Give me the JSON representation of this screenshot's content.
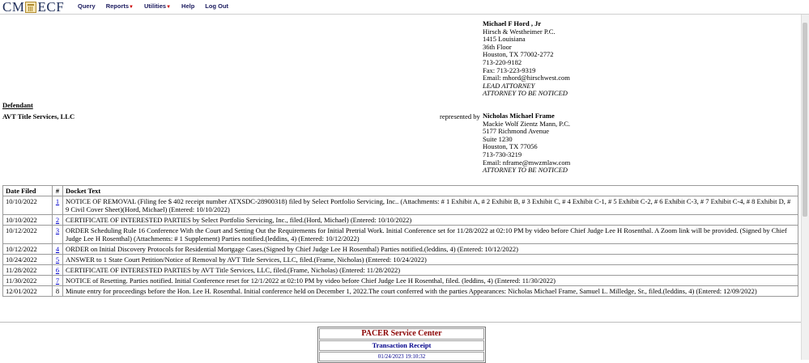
{
  "brand": {
    "cm": "CM",
    "ecf": "ECF"
  },
  "nav": [
    {
      "label": "Query",
      "dropdown": false
    },
    {
      "label": "Reports",
      "dropdown": true
    },
    {
      "label": "Utilities",
      "dropdown": true
    },
    {
      "label": "Help",
      "dropdown": false
    },
    {
      "label": "Log Out",
      "dropdown": false
    }
  ],
  "attorney_top": {
    "name": "Michael F Hord , Jr",
    "lines": [
      "Hirsch & Westheimer P.C.",
      "1415 Louisiana",
      "36th Floor",
      "Houston, TX 77002-2772",
      "713-220-9182",
      "Fax: 713-223-9319",
      "Email: mhord@hirschwest.com"
    ],
    "tags": [
      "LEAD ATTORNEY",
      "ATTORNEY TO BE NOTICED"
    ]
  },
  "defendant": {
    "header": "Defendant",
    "name": "AVT Title Services, LLC",
    "represented_by": "represented by",
    "attorney": {
      "name": "Nicholas Michael Frame",
      "lines": [
        "Mackie Wolf Zientz Mann, P.C.",
        "5177 Richmond Avenue",
        "Suite 1230",
        "Houston, TX 77056",
        "713-730-3219",
        "Email: nframe@mwzmlaw.com"
      ],
      "tags": [
        "ATTORNEY TO BE NOTICED"
      ]
    }
  },
  "docket": {
    "headers": [
      "Date Filed",
      "#",
      "Docket Text"
    ],
    "rows": [
      {
        "date": "10/10/2022",
        "num": "1",
        "link": true,
        "text": "NOTICE OF REMOVAL (Filing fee $ 402 receipt number ATXSDC-28900318) filed by Select Portfolio Servicing, Inc.. (Attachments: # 1 Exhibit A, # 2 Exhibit B, # 3 Exhibit C, # 4 Exhibit C-1, # 5 Exhibit C-2, # 6 Exhibit C-3, # 7 Exhibit C-4, # 8 Exhibit D, # 9 Civil Cover Sheet)(Hord, Michael) (Entered: 10/10/2022)"
      },
      {
        "date": "10/10/2022",
        "num": "2",
        "link": true,
        "text": "CERTIFICATE OF INTERESTED PARTIES by Select Portfolio Servicing, Inc., filed.(Hord, Michael) (Entered: 10/10/2022)"
      },
      {
        "date": "10/12/2022",
        "num": "3",
        "link": true,
        "text": "ORDER Scheduling Rule 16 Conference With the Court and Setting Out the Requirements for Initial Pretrial Work. Initial Conference set for 11/28/2022 at 02:10 PM by video before Chief Judge Lee H Rosenthal. A Zoom link will be provided. (Signed by Chief Judge Lee H Rosenthal) (Attachments: # 1 Supplement) Parties notified.(leddins, 4) (Entered: 10/12/2022)"
      },
      {
        "date": "10/12/2022",
        "num": "4",
        "link": true,
        "text": "ORDER on Initial Discovery Protocols for Residential Mortgage Cases.(Signed by Chief Judge Lee H Rosenthal) Parties notified.(leddins, 4) (Entered: 10/12/2022)"
      },
      {
        "date": "10/24/2022",
        "num": "5",
        "link": true,
        "text": "ANSWER to 1 State Court Petition/Notice of Removal by AVT Title Services, LLC, filed.(Frame, Nicholas) (Entered: 10/24/2022)"
      },
      {
        "date": "11/28/2022",
        "num": "6",
        "link": true,
        "text": "CERTIFICATE OF INTERESTED PARTIES by AVT Title Services, LLC, filed.(Frame, Nicholas) (Entered: 11/28/2022)"
      },
      {
        "date": "11/30/2022",
        "num": "7",
        "link": true,
        "text": "NOTICE of Resetting. Parties notified. Initial Conference reset for 12/1/2022 at 02:10 PM by video before Chief Judge Lee H Rosenthal, filed. (leddins, 4) (Entered: 11/30/2022)"
      },
      {
        "date": "12/01/2022",
        "num": "8",
        "link": false,
        "text": "Minute entry for proceedings before the Hon. Lee H. Rosenthal. Initial conference held on December 1, 2022.The court conferred with the parties Appearances: Nicholas Michael Frame, Samuel L. Milledge, Sr., filed.(leddins, 4) (Entered: 12/09/2022)"
      }
    ]
  },
  "receipt": {
    "title": "PACER Service Center",
    "subtitle": "Transaction Receipt",
    "datetime": "01/24/2023 19:10:32"
  }
}
